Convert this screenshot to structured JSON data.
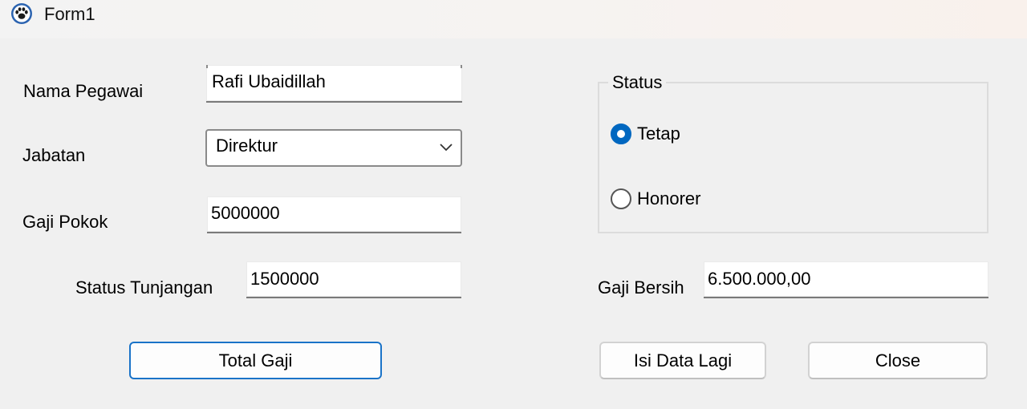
{
  "window": {
    "title": "Form1",
    "icon": "paw-icon"
  },
  "form": {
    "nama_pegawai": {
      "label": "Nama Pegawai",
      "value": "Rafi Ubaidillah"
    },
    "jabatan": {
      "label": "Jabatan",
      "selected": "Direktur"
    },
    "gaji_pokok": {
      "label": "Gaji Pokok",
      "value": "5000000"
    },
    "status_tunjangan": {
      "label": "Status Tunjangan",
      "value": "1500000"
    },
    "status_group": {
      "legend": "Status",
      "options": [
        {
          "label": "Tetap",
          "checked": true
        },
        {
          "label": "Honorer",
          "checked": false
        }
      ]
    },
    "gaji_bersih": {
      "label": "Gaji Bersih",
      "value": "6.500.000,00"
    }
  },
  "buttons": {
    "total_gaji": "Total Gaji",
    "isi_data_lagi": "Isi Data Lagi",
    "close": "Close"
  },
  "colors": {
    "accent": "#0067c0",
    "window_bg": "#f0f0f0",
    "default_button_border": "#1a73c8"
  }
}
